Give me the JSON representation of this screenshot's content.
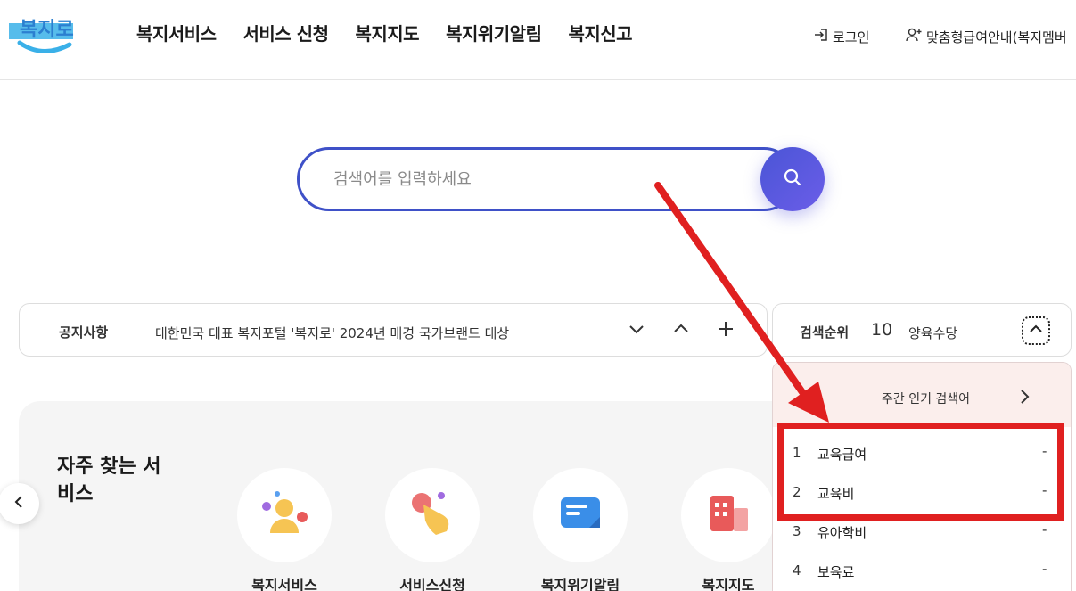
{
  "header": {
    "logo_text": "복지로",
    "nav": [
      "복지서비스",
      "서비스 신청",
      "복지지도",
      "복지위기알림",
      "복지신고"
    ],
    "login_label": "로그인",
    "member_label": "맞춤형급여안내(복지멤버"
  },
  "search": {
    "placeholder": "검색어를 입력하세요"
  },
  "notice": {
    "title": "공지사항",
    "text": "대한민국 대표 복지포털 '복지로' 2024년 매경 국가브랜드 대상"
  },
  "ranking": {
    "title": "검색순위",
    "current_rank": "10",
    "current_word": "양육수당",
    "panel_title": "주간 인기 검색어",
    "items": [
      {
        "rank": "1",
        "word": "교육급여",
        "delta": "-"
      },
      {
        "rank": "2",
        "word": "교육비",
        "delta": "-"
      },
      {
        "rank": "3",
        "word": "유아학비",
        "delta": "-"
      },
      {
        "rank": "4",
        "word": "보육료",
        "delta": "-"
      }
    ]
  },
  "services": {
    "title": "자주 찾는 서비스",
    "items": [
      {
        "label": "복지서비스"
      },
      {
        "label": "서비스신청"
      },
      {
        "label": "복지위기알림"
      },
      {
        "label": "복지지도"
      }
    ]
  },
  "colors": {
    "accent": "#3f51c8",
    "annotation": "#e02020"
  }
}
